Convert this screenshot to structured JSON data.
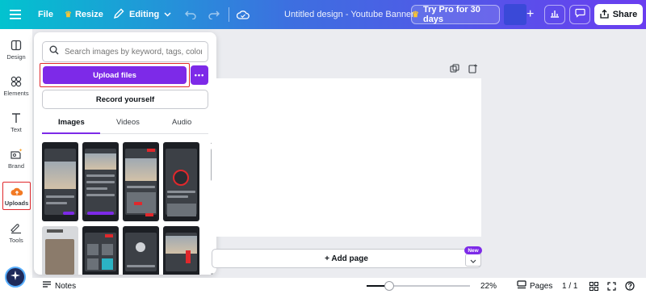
{
  "topbar": {
    "file_label": "File",
    "resize_label": "Resize",
    "editing_label": "Editing",
    "title": "Untitled design - Youtube Banner",
    "try_pro_label": "Try Pro for 30 days",
    "share_label": "Share",
    "colors": {
      "gradient_start": "#02c3cf",
      "gradient_end": "#6a3df0"
    }
  },
  "rail": {
    "items": [
      {
        "label": "Design",
        "icon": "design-icon"
      },
      {
        "label": "Elements",
        "icon": "elements-icon"
      },
      {
        "label": "Text",
        "icon": "text-icon"
      },
      {
        "label": "Brand",
        "icon": "brand-icon"
      },
      {
        "label": "Uploads",
        "icon": "upload-cloud-icon",
        "active": true
      },
      {
        "label": "Tools",
        "icon": "tools-icon"
      }
    ]
  },
  "panel": {
    "search_placeholder": "Search images by keyword, tags, color...",
    "upload_label": "Upload files",
    "more_label": "•••",
    "record_label": "Record yourself",
    "tabs": [
      "Images",
      "Videos",
      "Audio"
    ],
    "active_tab": "Images"
  },
  "canvas": {
    "add_page_label": "+ Add page",
    "new_badge": "New"
  },
  "bottombar": {
    "notes_label": "Notes",
    "zoom_label": "22%",
    "zoom_fraction": 0.22,
    "pages_label": "Pages",
    "page_count": "1 / 1"
  },
  "accent": "#7d2ae8"
}
